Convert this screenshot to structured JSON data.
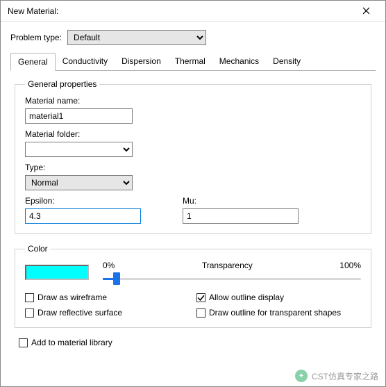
{
  "window": {
    "title": "New Material:"
  },
  "problemType": {
    "label": "Problem type:",
    "value": "Default"
  },
  "tabs": {
    "general": "General",
    "conductivity": "Conductivity",
    "dispersion": "Dispersion",
    "thermal": "Thermal",
    "mechanics": "Mechanics",
    "density": "Density"
  },
  "generalProps": {
    "legend": "General properties",
    "materialNameLabel": "Material name:",
    "materialName": "material1",
    "materialFolderLabel": "Material folder:",
    "materialFolder": "",
    "typeLabel": "Type:",
    "type": "Normal",
    "epsilonLabel": "Epsilon:",
    "epsilon": "4.3",
    "muLabel": "Mu:",
    "mu": "1"
  },
  "colorGroup": {
    "legend": "Color",
    "swatch": "#00ffff",
    "transparencyLabel": "Transparency",
    "min": "0%",
    "max": "100%",
    "drawWireframe": "Draw as wireframe",
    "allowOutline": "Allow outline display",
    "drawReflective": "Draw reflective surface",
    "drawOutlineTransparent": "Draw outline for transparent shapes"
  },
  "addToLibrary": "Add to material library",
  "watermark": "CST仿真专家之路"
}
